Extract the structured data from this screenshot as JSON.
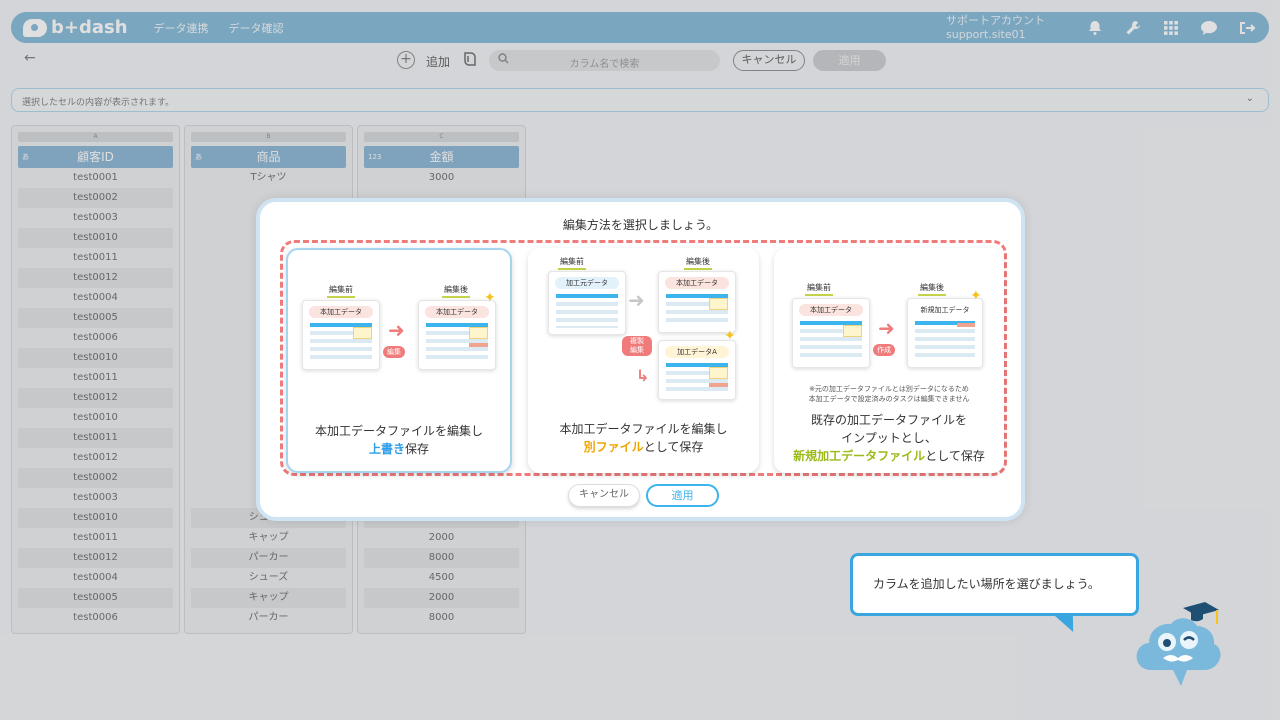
{
  "header": {
    "logo": "b+dash",
    "nav": [
      "データ連携",
      "データ確認"
    ],
    "account_name": "サポートアカウント",
    "account_id": "support.site01"
  },
  "toolbar": {
    "add_label": "追加",
    "search_placeholder": "カラム名で検索",
    "cancel": "キャンセル",
    "apply": "適用"
  },
  "cellbar": {
    "text": "選択したセルの内容が表示されます。"
  },
  "table": {
    "columns": [
      {
        "letter": "A",
        "type": "あ",
        "name": "顧客ID"
      },
      {
        "letter": "B",
        "type": "あ",
        "name": "商品"
      },
      {
        "letter": "C",
        "type": "123",
        "name": "金額"
      }
    ],
    "col_a": [
      "test0001",
      "test0002",
      "test0003",
      "test0010",
      "test0011",
      "test0012",
      "test0004",
      "test0005",
      "test0006",
      "test0010",
      "test0011",
      "test0012",
      "test0010",
      "test0011",
      "test0012",
      "test0002",
      "test0003",
      "test0010",
      "test0011",
      "test0012",
      "test0004",
      "test0005",
      "test0006"
    ],
    "col_b_bottom": [
      "シューズ",
      "キャップ",
      "パーカー",
      "シューズ",
      "キャップ",
      "パーカー"
    ],
    "col_b_top": [
      "Tシャツ"
    ],
    "col_c_top": [
      "3000"
    ],
    "col_c_bottom": [
      "4500",
      "2000",
      "8000",
      "4500",
      "2000",
      "8000"
    ]
  },
  "modal": {
    "title": "編集方法を選択しましょう。",
    "labels": {
      "before": "編集前",
      "after": "編集後",
      "edit": "編集",
      "copy_edit": "複製\n編集",
      "create": "作成"
    },
    "docs": {
      "processed": "本加工データ",
      "source": "加工元データ",
      "processed_a": "加工データA",
      "new_processed": "新規加工データ"
    },
    "opt1_line1": "本加工データファイルを編集し",
    "opt1_hl": "上書き",
    "opt1_tail": "保存",
    "opt2_line1": "本加工データファイルを編集し",
    "opt2_hl": "別ファイル",
    "opt2_tail": "として保存",
    "opt3_note1": "※元の加工データファイルとは別データになるため",
    "opt3_note2": "本加工データで設定済みのタスクは編集できません",
    "opt3_line1": "既存の加工データファイルを",
    "opt3_line2": "インプットとし、",
    "opt3_hl": "新規加工データファイル",
    "opt3_tail": "として保存",
    "cancel": "キャンセル",
    "apply": "適用"
  },
  "tooltip": {
    "text": "カラムを追加したい場所を選びましょう。"
  }
}
